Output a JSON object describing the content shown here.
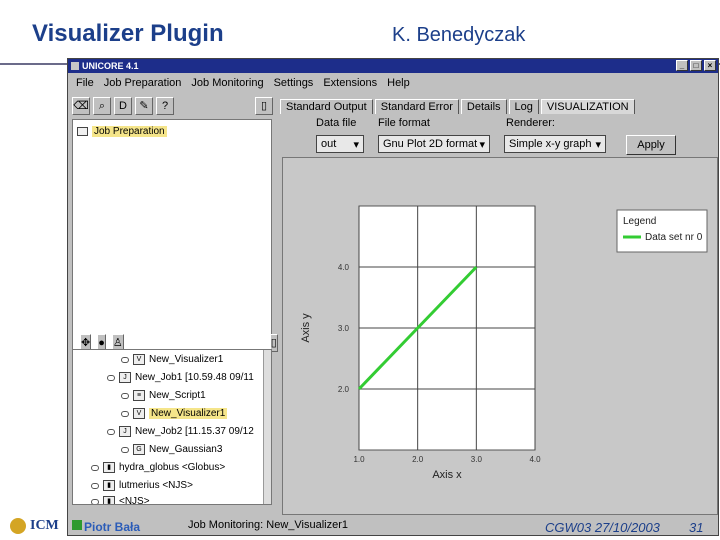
{
  "slide": {
    "title": "Visualizer Plugin",
    "author": "K. Benedyczak",
    "footer_left": "Piotr Bała",
    "footer_right": "CGW03 27/10/2003",
    "page_number": "31"
  },
  "window": {
    "title": "UNICORE 4.1",
    "min": "_",
    "max": "□",
    "close": "×"
  },
  "menu": [
    "File",
    "Job Preparation",
    "Job Monitoring",
    "Settings",
    "Extensions",
    "Help"
  ],
  "tree_top": {
    "root_label": "Job Preparation"
  },
  "tree_bottom": {
    "rows": [
      "New_Visualizer1",
      "New_Job1 [10.59.48 09/11",
      "New_Script1",
      "New_Visualizer1",
      "New_Job2 [11.15.37 09/12",
      "New_Gaussian3",
      "hydra_globus <Globus>",
      "lutmerius <NJS>",
      "<NJS>"
    ]
  },
  "status": {
    "text": "Job Monitoring: New_Visualizer1"
  },
  "tabs": [
    "Standard Output",
    "Standard Error",
    "Details",
    "Log",
    "VISUALIZATION"
  ],
  "form": {
    "data_file_label": "Data file",
    "file_format_label": "File format",
    "renderer_label": "Renderer:",
    "data_file_value": "out",
    "file_format_value": "Gnu Plot 2D format",
    "renderer_value": "Simple x-y graph",
    "apply_label": "Apply"
  },
  "chart_data": {
    "type": "line",
    "xlabel": "Axis x",
    "ylabel": "Axis y",
    "xlim": [
      1.0,
      4.0
    ],
    "ylim": [
      1.0,
      5.0
    ],
    "x_ticks": [
      "1.0",
      "2.0",
      "3.0",
      "4.0"
    ],
    "y_ticks": [
      "2.0",
      "3.0",
      "4.0"
    ],
    "legend_title": "Legend",
    "legend_position": "top-right",
    "series": [
      {
        "name": "Data set nr 0",
        "color": "#33cc33",
        "x": [
          1.0,
          3.0
        ],
        "y": [
          2.0,
          4.0
        ]
      }
    ],
    "grid": true
  }
}
